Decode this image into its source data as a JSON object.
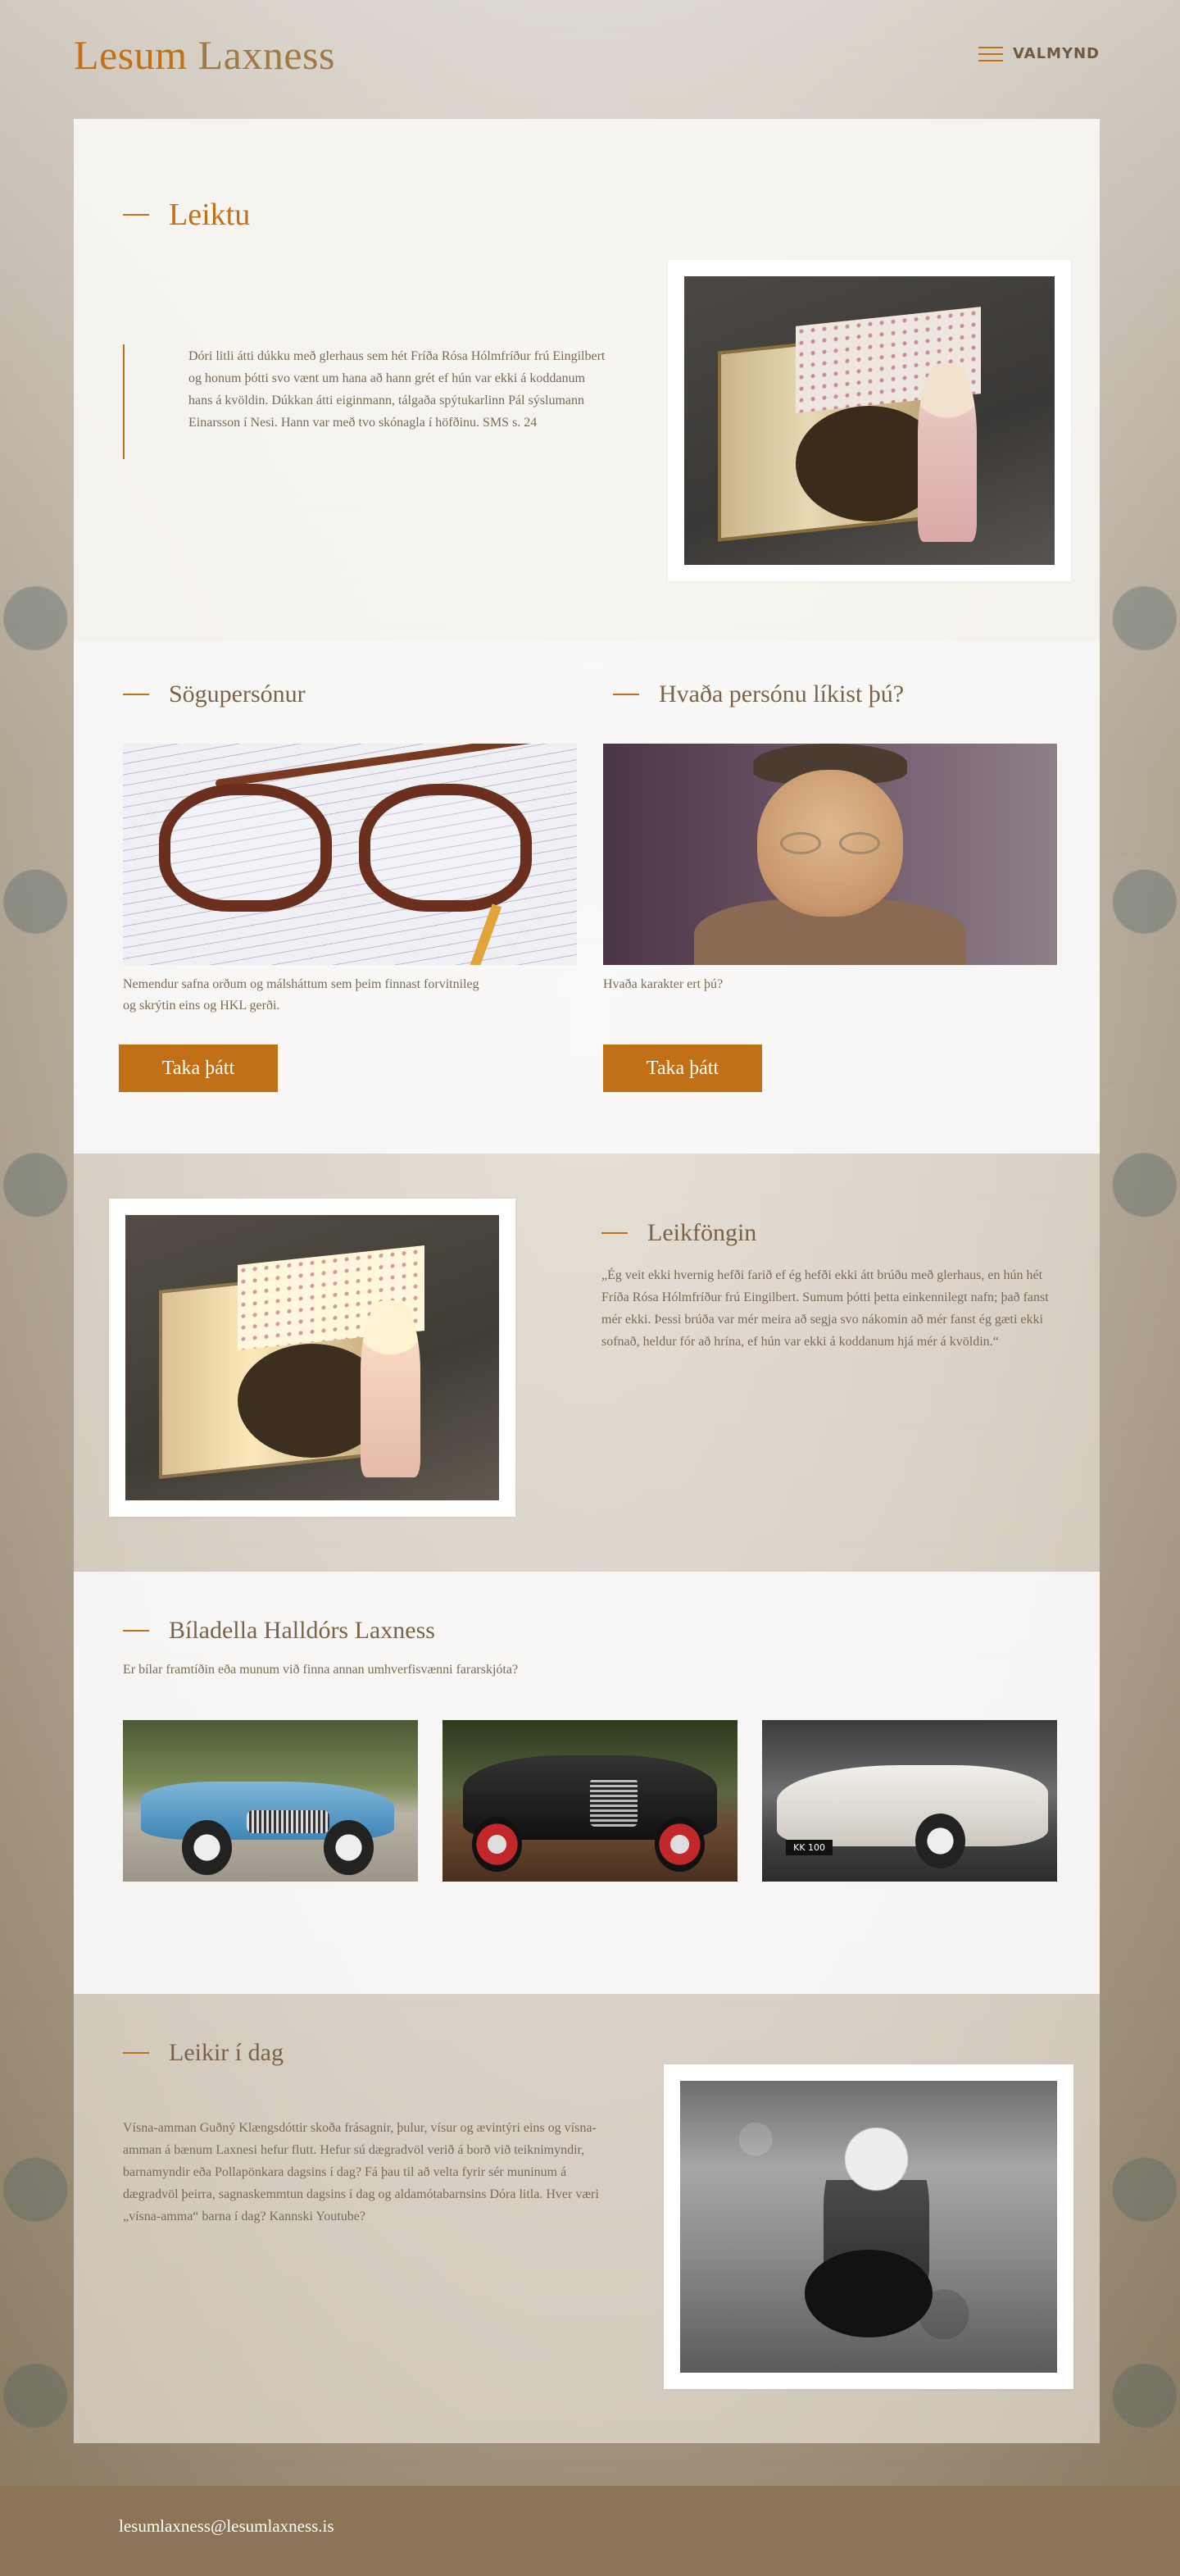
{
  "header": {
    "logo_first": "Lesum",
    "logo_second": "Laxness",
    "menu_label": "VALMYND",
    "menu_icon": "hamburger-icon"
  },
  "leiktu": {
    "title": "Leiktu",
    "text": "Dóri litli átti dúkku með glerhaus sem hét Fríða Rósa Hólmfríður frú Eingilbert og honum þótti svo vænt um hana að hann grét ef hún var ekki á koddanum hans á kvöldin. Dúkkan átti eiginmann, tálgaða spýtukarlinn Pál sýslumann Einarsson í Nesi. Hann var með tvo skónagla í höfðinu. SMS s. 24"
  },
  "sogupersonur": {
    "title": "Sögupersónur",
    "text": "Nemendur safna orðum og málsháttum sem þeim finnast forvitnileg og skrýtin eins og HKL gerði.",
    "button": "Taka þátt"
  },
  "hvada_persona": {
    "title": "Hvaða persónu líkist þú?",
    "text": "Hvaða karakter ert þú?",
    "button": "Taka þátt"
  },
  "leikfongin": {
    "title": "Leikföngin",
    "text": "„Ég veit ekki hvernig hefði farið ef ég hefði ekki átt brúðu með glerhaus, en hún hét Fríða Rósa Hólmfríður frú Eingilbert. Sumum þótti þetta einkennilegt nafn; það fanst mér ekki. Þessi brúða var mér meira að segja svo nákomin að mér fanst ég gæti ekki sofnað, heldur fór að hrína, ef hún var ekki á koddanum hjá mér á kvöldin.“"
  },
  "biladella": {
    "title": "Bíladella Halldórs Laxness",
    "subtitle": "Er bílar framtíðin eða munum við finna annan umhverfisvænni fararskjóta?",
    "plate_text": "KK 100"
  },
  "leikir": {
    "title": "Leikir í dag",
    "text": "Vísna-amman Guðný Klængsdóttir skoða frásagnir, þulur, vísur og ævintýri eins og vísna-amman á bænum Laxnesi hefur flutt. Hefur sú dægradvöl verið á borð við teiknimyndir, barnamyndir eða Pollapönkara dagsins í dag? Fá þau til að velta fyrir sér muninum á dægradvöl þeirra, sagnaskemmtun dagsins í dag og aldamótabarnsins Dóra litla.  Hver væri „vísna-amma“ barna í dag? Kannski Youtube?"
  },
  "footer": {
    "email": "lesumlaxness@lesumlaxness.is"
  },
  "colors": {
    "accent": "#c27016",
    "brown_text": "#7a6348",
    "footer_bg": "#8b7355"
  }
}
